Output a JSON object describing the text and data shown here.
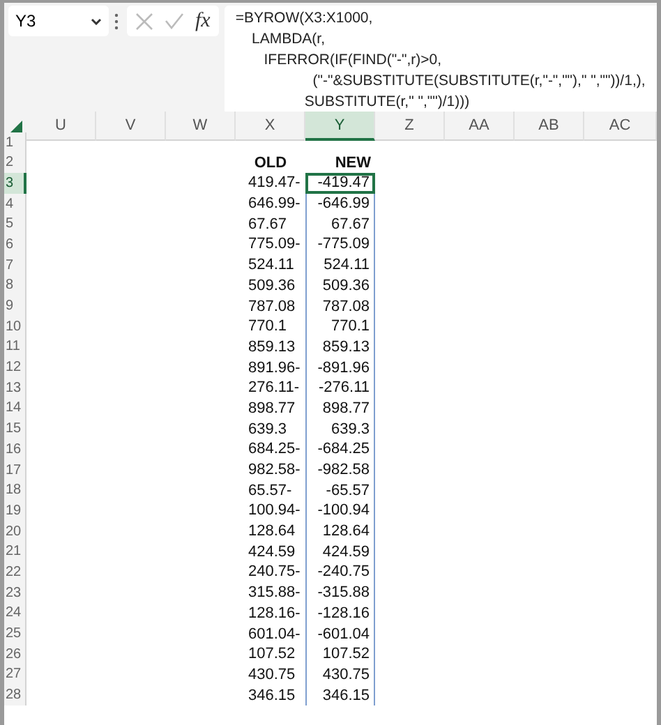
{
  "name_box": {
    "value": "Y3"
  },
  "formula_bar": {
    "fx_label": "fx",
    "formula": "=BYROW(X3:X1000,\n    LAMBDA(r,\n       IFERROR(IF(FIND(\"-\",r)>0,\n                   (\"-\"&SUBSTITUTE(SUBSTITUTE(r,\"-\",\"\"),\" \",\"\"))/1,),\n                 SUBSTITUTE(r,\" \",\"\")/1)))"
  },
  "columns": [
    {
      "label": "U",
      "selected": false
    },
    {
      "label": "V",
      "selected": false
    },
    {
      "label": "W",
      "selected": false
    },
    {
      "label": "X",
      "selected": false
    },
    {
      "label": "Y",
      "selected": true
    },
    {
      "label": "Z",
      "selected": false
    },
    {
      "label": "AA",
      "selected": false
    },
    {
      "label": "AB",
      "selected": false
    },
    {
      "label": "AC",
      "selected": false
    }
  ],
  "rows": [
    {
      "number": "1",
      "selected": false
    },
    {
      "number": "2",
      "selected": false,
      "old": "OLD",
      "new": "NEW",
      "kind": "header"
    },
    {
      "number": "3",
      "selected": true,
      "spill": true,
      "old": "419.47-",
      "new": "-419.47"
    },
    {
      "number": "4",
      "selected": false,
      "spill": true,
      "old": "646.99-",
      "new": "-646.99"
    },
    {
      "number": "5",
      "selected": false,
      "spill": true,
      "old": "67.67",
      "new": "67.67"
    },
    {
      "number": "6",
      "selected": false,
      "spill": true,
      "old": "775.09-",
      "new": "-775.09"
    },
    {
      "number": "7",
      "selected": false,
      "spill": true,
      "old": "524.11",
      "new": "524.11"
    },
    {
      "number": "8",
      "selected": false,
      "spill": true,
      "old": "509.36",
      "new": "509.36"
    },
    {
      "number": "9",
      "selected": false,
      "spill": true,
      "old": "787.08",
      "new": "787.08"
    },
    {
      "number": "10",
      "selected": false,
      "spill": true,
      "old": "770.1",
      "new": "770.1"
    },
    {
      "number": "11",
      "selected": false,
      "spill": true,
      "old": "859.13",
      "new": "859.13"
    },
    {
      "number": "12",
      "selected": false,
      "spill": true,
      "old": "891.96-",
      "new": "-891.96"
    },
    {
      "number": "13",
      "selected": false,
      "spill": true,
      "old": "276.11-",
      "new": "-276.11"
    },
    {
      "number": "14",
      "selected": false,
      "spill": true,
      "old": "898.77",
      "new": "898.77"
    },
    {
      "number": "15",
      "selected": false,
      "spill": true,
      "old": "639.3",
      "new": "639.3"
    },
    {
      "number": "16",
      "selected": false,
      "spill": true,
      "old": "684.25-",
      "new": "-684.25"
    },
    {
      "number": "17",
      "selected": false,
      "spill": true,
      "old": "982.58-",
      "new": "-982.58"
    },
    {
      "number": "18",
      "selected": false,
      "spill": true,
      "old": "65.57-",
      "new": "-65.57"
    },
    {
      "number": "19",
      "selected": false,
      "spill": true,
      "old": "100.94-",
      "new": "-100.94"
    },
    {
      "number": "20",
      "selected": false,
      "spill": true,
      "old": "128.64",
      "new": "128.64"
    },
    {
      "number": "21",
      "selected": false,
      "spill": true,
      "old": "424.59",
      "new": "424.59"
    },
    {
      "number": "22",
      "selected": false,
      "spill": true,
      "old": "240.75-",
      "new": "-240.75"
    },
    {
      "number": "23",
      "selected": false,
      "spill": true,
      "old": "315.88-",
      "new": "-315.88"
    },
    {
      "number": "24",
      "selected": false,
      "spill": true,
      "old": "128.16-",
      "new": "-128.16"
    },
    {
      "number": "25",
      "selected": false,
      "spill": true,
      "old": "601.04-",
      "new": "-601.04"
    },
    {
      "number": "26",
      "selected": false,
      "spill": true,
      "old": "107.52",
      "new": "107.52"
    },
    {
      "number": "27",
      "selected": false,
      "spill": true,
      "old": "430.75",
      "new": "430.75"
    },
    {
      "number": "28",
      "selected": false,
      "spill": true,
      "old": "346.15",
      "new": "346.15"
    }
  ]
}
